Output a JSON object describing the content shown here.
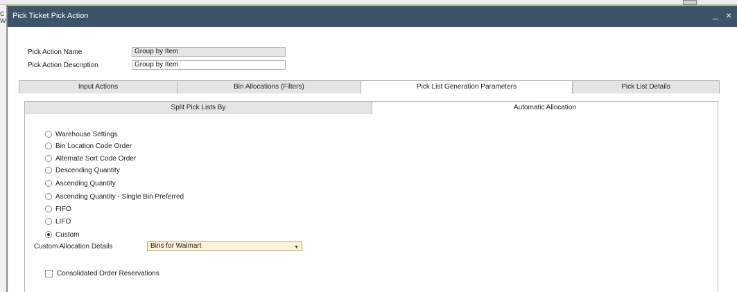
{
  "window": {
    "title": "Pick Ticket Pick Action",
    "minimize_glyph": "_",
    "close_glyph": "×"
  },
  "background": {
    "left_fragment_text": "C\nW"
  },
  "header": {
    "name_label": "Pick Action Name",
    "name_value": "Group by Item",
    "description_label": "Pick Action Description",
    "description_value": "Group by Item"
  },
  "tabs": [
    {
      "label": "Input Actions",
      "active": false
    },
    {
      "label": "Bin Allocations (Filters)",
      "active": false
    },
    {
      "label": "Pick List Generation Parameters",
      "active": true
    },
    {
      "label": "Pick List Details",
      "active": false
    }
  ],
  "subtabs": [
    {
      "label": "Split Pick Lists By",
      "active": false
    },
    {
      "label": "Automatic Allocation",
      "active": true
    }
  ],
  "allocation_options": [
    {
      "label": "Warehouse Settings",
      "selected": false
    },
    {
      "label": "Bin Location Code Order",
      "selected": false
    },
    {
      "label": "Alternate Sort Code Order",
      "selected": false
    },
    {
      "label": "Descending Quantity",
      "selected": false
    },
    {
      "label": "Ascending Quantity",
      "selected": false
    },
    {
      "label": "Ascending Quantity - Single Bin Preferred",
      "selected": false
    },
    {
      "label": "FIFO",
      "selected": false
    },
    {
      "label": "LIFO",
      "selected": false
    },
    {
      "label": "Custom",
      "selected": true
    }
  ],
  "custom_allocation": {
    "label": "Custom Allocation Details",
    "value": "Bins for Walmart"
  },
  "consolidated": {
    "label": "Consolidated Order Reservations",
    "checked": false
  }
}
